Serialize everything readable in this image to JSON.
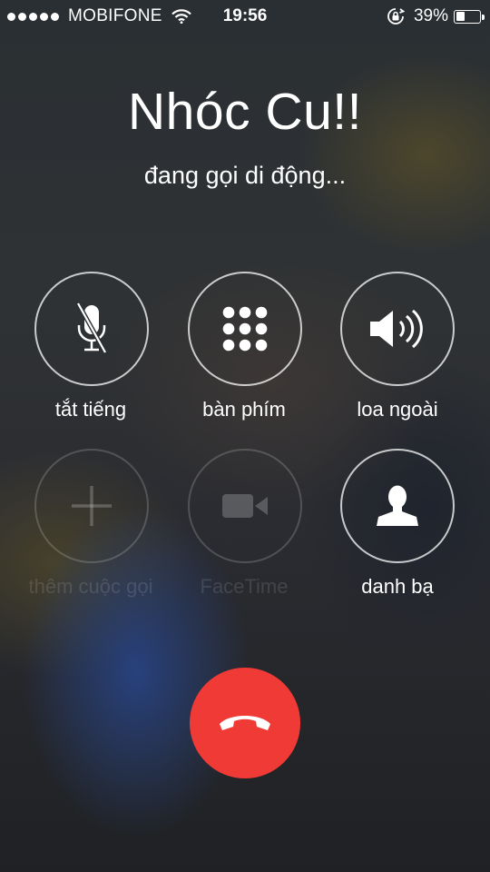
{
  "status_bar": {
    "carrier": "MOBIFONE",
    "time": "19:56",
    "battery_percent_text": "39%",
    "battery_level": 0.39,
    "signal_bars": 5,
    "icons": [
      "signal-dots-icon",
      "wifi-icon",
      "rotation-lock-icon",
      "battery-icon"
    ]
  },
  "call": {
    "contact_name": "Nhóc Cu!!",
    "status_text": "đang gọi di động..."
  },
  "controls": {
    "mute": {
      "label": "tắt tiếng",
      "icon": "microphone-muted-icon",
      "enabled": true
    },
    "keypad": {
      "label": "bàn phím",
      "icon": "keypad-icon",
      "enabled": true
    },
    "speaker": {
      "label": "loa ngoài",
      "icon": "speaker-icon",
      "enabled": true
    },
    "add_call": {
      "label": "thêm cuộc gọi",
      "icon": "plus-icon",
      "enabled": false
    },
    "facetime": {
      "label": "FaceTime",
      "icon": "video-camera-icon",
      "enabled": false
    },
    "contacts": {
      "label": "danh bạ",
      "icon": "contact-person-icon",
      "enabled": true
    }
  },
  "end_call": {
    "icon": "phone-hangup-icon",
    "color": "#f03a35"
  }
}
